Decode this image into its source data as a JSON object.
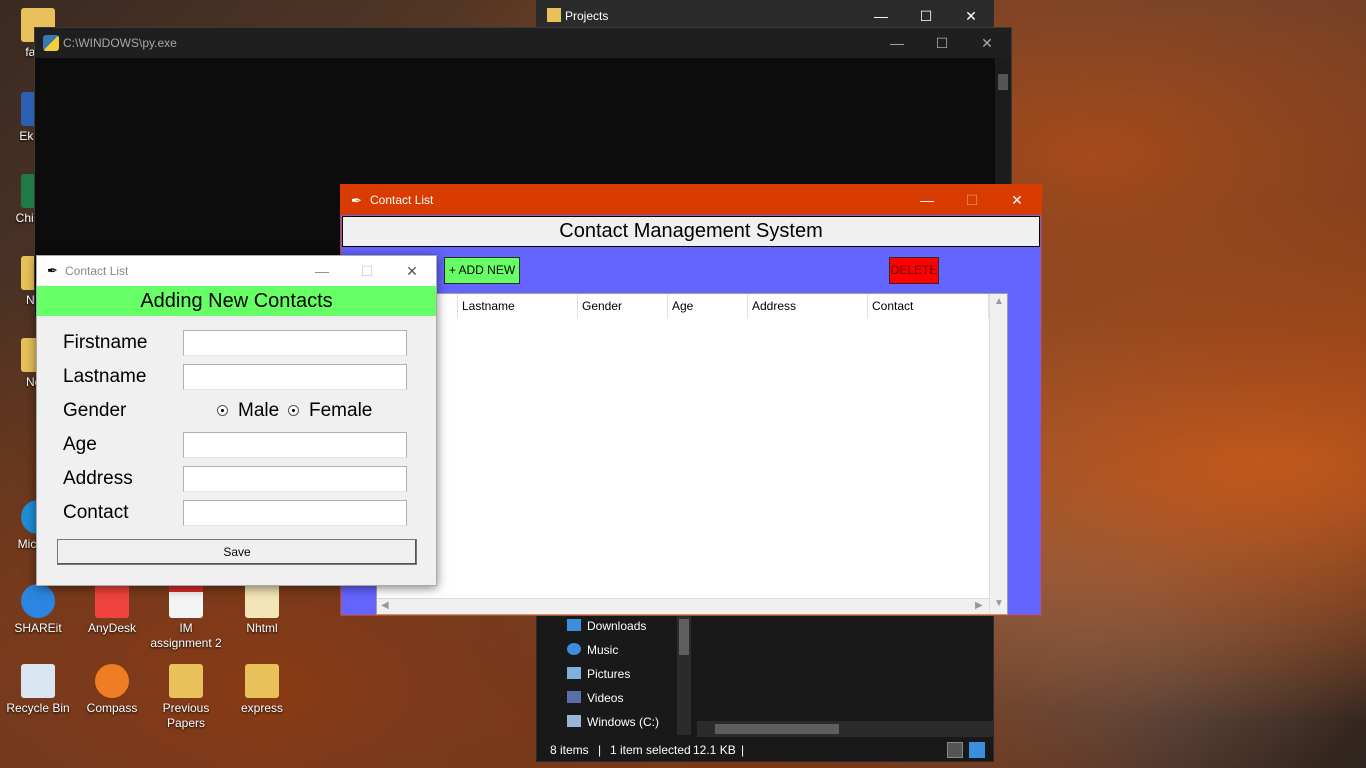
{
  "desktop_icons": [
    {
      "label": "fav s",
      "icon": "folder-icon"
    },
    {
      "label": "Ek bha",
      "icon": "word-document-icon"
    },
    {
      "label": "Chil Sch",
      "icon": "excel-document-icon"
    },
    {
      "label": "New",
      "icon": "folder-icon"
    },
    {
      "label": "New",
      "icon": "folder-icon"
    },
    {
      "label": "Micr Ed",
      "icon": "edge-icon"
    },
    {
      "label": "SHAREit",
      "icon": "shareit-icon"
    },
    {
      "label": "AnyDesk",
      "icon": "anydesk-icon"
    },
    {
      "label": "IM assignment 2",
      "icon": "pdf-icon"
    },
    {
      "label": "Nhtml",
      "icon": "chrome-document-icon"
    },
    {
      "label": "Recycle Bin",
      "icon": "recycle-bin-icon"
    },
    {
      "label": "Compass",
      "icon": "compass-icon"
    },
    {
      "label": "Previous Papers",
      "icon": "folder-icon"
    },
    {
      "label": "express",
      "icon": "folder-zip-icon"
    }
  ],
  "explorer": {
    "title": "Projects",
    "nav_items": [
      "Downloads",
      "Music",
      "Pictures",
      "Videos",
      "Windows (C:)"
    ],
    "status": {
      "items": "8 items",
      "selected": "1 item selected",
      "size": "12.1 KB"
    }
  },
  "console": {
    "title": "C:\\WINDOWS\\py.exe"
  },
  "main_window": {
    "title": "Contact List",
    "header": "Contact Management System",
    "add_button": "+ ADD NEW",
    "delete_button": "DELETE",
    "columns": [
      "Lastname",
      "Gender",
      "Age",
      "Address",
      "Contact"
    ],
    "accent": "#da3b01",
    "background": "#6464ff"
  },
  "dialog": {
    "title": "Contact List",
    "header": "Adding New Contacts",
    "labels": {
      "firstname": "Firstname",
      "lastname": "Lastname",
      "gender": "Gender",
      "age": "Age",
      "address": "Address",
      "contact": "Contact"
    },
    "gender_options": [
      "Male",
      "Female"
    ],
    "values": {
      "firstname": "",
      "lastname": "",
      "age": "",
      "address": "",
      "contact": ""
    },
    "save_button": "Save",
    "header_color": "#66ff66"
  },
  "window_controls": {
    "minimize": "—",
    "maximize": "☐",
    "close": "✕"
  }
}
